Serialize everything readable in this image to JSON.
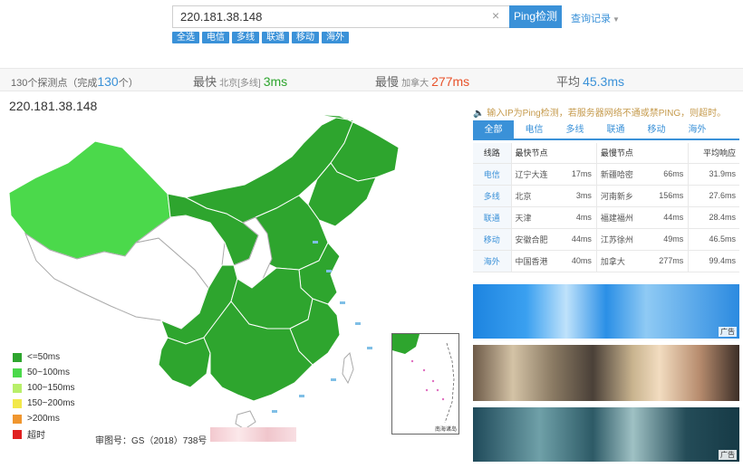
{
  "search": {
    "value": "220.181.38.148",
    "button": "Ping检测",
    "history": "查询记录",
    "clear": "×"
  },
  "chips": [
    "全选",
    "电信",
    "多线",
    "联通",
    "移动",
    "海外"
  ],
  "stats": {
    "probes_prefix": "130个探测点（完成",
    "probes_count": "130",
    "probes_suffix": "个）",
    "fastest_label": "最快",
    "fastest_node": "北京[多线]",
    "fastest_value": "3ms",
    "slowest_label": "最慢",
    "slowest_node": "加拿大",
    "slowest_value": "277ms",
    "avg_label": "平均",
    "avg_value": "45.3ms"
  },
  "ip_title": "220.181.38.148",
  "legend": [
    {
      "label": "<=50ms",
      "color": "#2ea52e"
    },
    {
      "label": "50~100ms",
      "color": "#4bd94b"
    },
    {
      "label": "100~150ms",
      "color": "#b8ef6a"
    },
    {
      "label": "150~200ms",
      "color": "#f2e84a"
    },
    {
      "label": ">200ms",
      "color": "#f0962f"
    },
    {
      "label": "超时",
      "color": "#e02020"
    }
  ],
  "approval": "审图号：GS（2018）738号",
  "inset_caption": "南海诸岛",
  "tip": "输入IP为Ping检测，若服务器网络不通或禁PING，则超时。",
  "tabs": [
    "全部",
    "电信",
    "多线",
    "联通",
    "移动",
    "海外"
  ],
  "table": {
    "headers": {
      "line": "线路",
      "fastest": "最快节点",
      "slowest": "最慢节点",
      "avg": "平均响应"
    },
    "rows": [
      {
        "line": "电信",
        "fn": "辽宁大连",
        "fv": "17ms",
        "sn": "新疆哈密",
        "sv": "66ms",
        "avg": "31.9ms"
      },
      {
        "line": "多线",
        "fn": "北京",
        "fv": "3ms",
        "sn": "河南新乡",
        "sv": "156ms",
        "avg": "27.6ms"
      },
      {
        "line": "联通",
        "fn": "天津",
        "fv": "4ms",
        "sn": "福建福州",
        "sv": "44ms",
        "avg": "28.4ms"
      },
      {
        "line": "移动",
        "fn": "安徽合肥",
        "fv": "44ms",
        "sn": "江苏徐州",
        "sv": "49ms",
        "avg": "46.5ms"
      },
      {
        "line": "海外",
        "fn": "中国香港",
        "fv": "40ms",
        "sn": "加拿大",
        "sv": "277ms",
        "avg": "99.4ms"
      }
    ]
  },
  "ad_tag": "广告",
  "ad_tag3": "广告"
}
